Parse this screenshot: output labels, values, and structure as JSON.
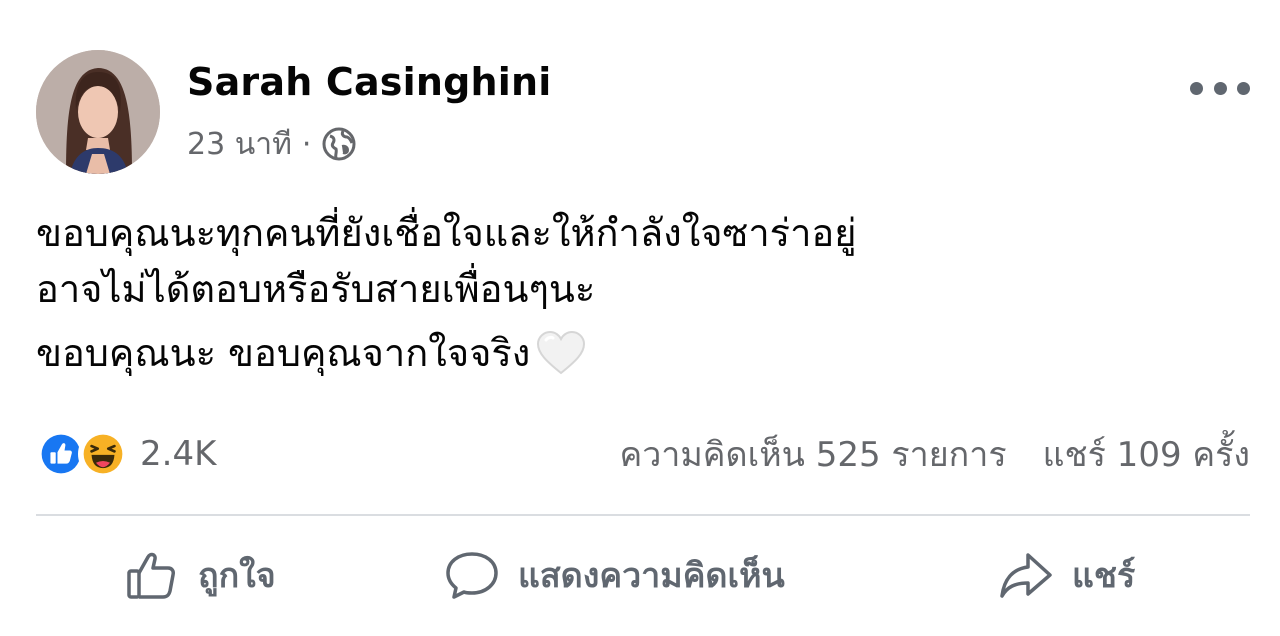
{
  "author": {
    "name": "Sarah Casinghini",
    "timestamp": "23 นาที",
    "separator": "·",
    "privacy_icon": "globe-icon"
  },
  "post": {
    "lines": [
      "ขอบคุณนะทุกคนที่ยังเชื่อใจและให้กำลังใจซาร่าอยู่",
      "อาจไม่ได้ตอบหรือรับสายเพื่อนๆนะ",
      "ขอบคุณนะ ขอบคุณจากใจจริง"
    ],
    "emoji": "white-heart-icon"
  },
  "stats": {
    "reactions": [
      "like-reaction-icon",
      "haha-reaction-icon"
    ],
    "reaction_count": "2.4K",
    "comments": "ความคิดเห็น 525 รายการ",
    "shares": "แชร์ 109 ครั้ง"
  },
  "actions": {
    "like_label": "ถูกใจ",
    "comment_label": "แสดงความคิดเห็น",
    "share_label": "แชร์"
  },
  "colors": {
    "like_blue": "#1877f2",
    "haha_yellow": "#f7b125",
    "secondary_text": "#65676b",
    "divider": "#dadde1"
  }
}
